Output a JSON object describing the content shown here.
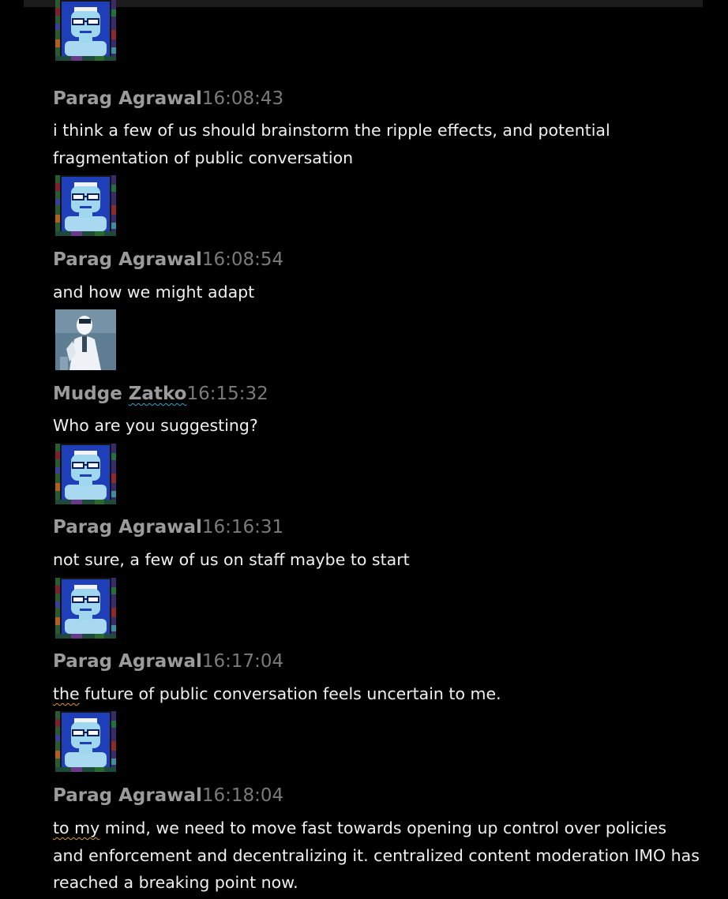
{
  "messages": [
    {
      "author": "Parag Agrawal",
      "time": "16:08:43",
      "text": "i think a few of us should brainstorm the ripple effects, and potential fragmentation of public conversation"
    },
    {
      "author": "Parag Agrawal",
      "time": "16:08:54",
      "text": "and how we might adapt"
    },
    {
      "author": "Mudge Zatko",
      "author_first": "Mudge ",
      "author_last": "Zatko",
      "time": "16:15:32",
      "text": "Who are you suggesting?"
    },
    {
      "author": "Parag Agrawal",
      "time": "16:16:31",
      "text": "not sure, a few of us on staff maybe to start"
    },
    {
      "author": "Parag Agrawal",
      "time": "16:17:04",
      "text_first": "the",
      "text_rest": " future of public conversation feels uncertain to me."
    },
    {
      "author": "Parag Agrawal",
      "time": "16:18:04",
      "text_first": "to my",
      "text_rest": " mind, we need to move fast towards opening up control over policies and enforcement and decentralizing it. centralized content moderation IMO has reached a breaking point now."
    }
  ],
  "colors": {
    "background": "#000000",
    "author": "#9b9b9b",
    "timestamp": "#7a7a7a",
    "message_text": "#f0f0f0",
    "spellcheck_blue": "#2aa7c9",
    "spellcheck_orange": "#d99a2b"
  },
  "icons": {
    "parag_avatar": "pixel-portrait-avatar",
    "mudge_avatar": "photo-portrait-avatar"
  }
}
